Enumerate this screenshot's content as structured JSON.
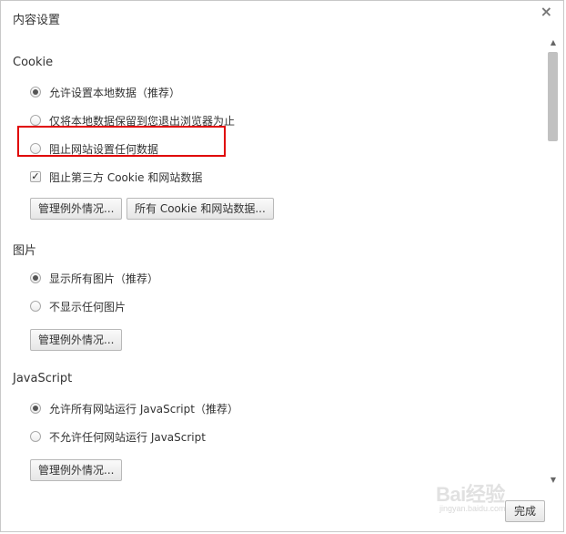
{
  "dialog": {
    "title": "内容设置",
    "close_glyph": "×",
    "done_label": "完成"
  },
  "cookie": {
    "heading": "Cookie",
    "options": [
      {
        "label": "允许设置本地数据（推荐）",
        "checked": true
      },
      {
        "label": "仅将本地数据保留到您退出浏览器为止",
        "checked": false
      },
      {
        "label": "阻止网站设置任何数据",
        "checked": false
      }
    ],
    "block_third_party": {
      "label": "阻止第三方 Cookie 和网站数据",
      "checked": true
    },
    "manage_label": "管理例外情况...",
    "all_cookies_label": "所有 Cookie 和网站数据..."
  },
  "images": {
    "heading": "图片",
    "options": [
      {
        "label": "显示所有图片（推荐）",
        "checked": true
      },
      {
        "label": "不显示任何图片",
        "checked": false
      }
    ],
    "manage_label": "管理例外情况..."
  },
  "javascript": {
    "heading": "JavaScript",
    "options": [
      {
        "label": "允许所有网站运行 JavaScript（推荐）",
        "checked": true
      },
      {
        "label": "不允许任何网站运行 JavaScript",
        "checked": false
      }
    ],
    "manage_label": "管理例外情况..."
  },
  "scrollbar": {
    "up_glyph": "▲",
    "down_glyph": "▼"
  },
  "watermark": {
    "text": "Bai经验",
    "sub": "jingyan.baidu.com"
  },
  "colors": {
    "highlight": "#e00000",
    "thumb": "#c1c1c1"
  }
}
